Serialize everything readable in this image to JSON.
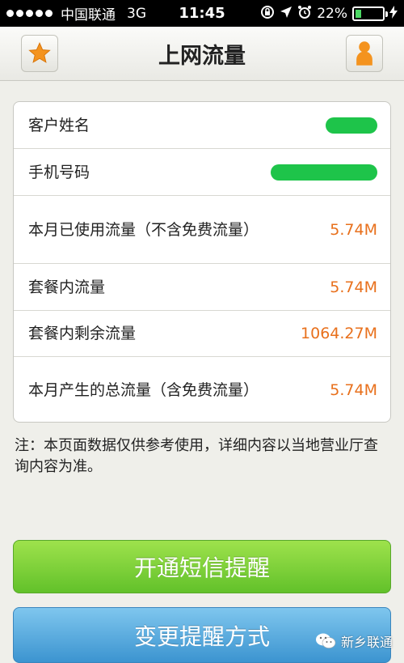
{
  "status_bar": {
    "carrier": "中国联通",
    "network": "3G",
    "time": "11:45",
    "battery": "22%",
    "battery_level": 0.22
  },
  "nav": {
    "title": "上网流量",
    "left_icon": "star-icon",
    "right_icon": "person-icon"
  },
  "rows": [
    {
      "label": "客户姓名",
      "value": ""
    },
    {
      "label": "手机号码",
      "value": ""
    },
    {
      "label": "本月已使用流量（不含免费流量）",
      "value": "5.74M"
    },
    {
      "label": "套餐内流量",
      "value": "5.74M"
    },
    {
      "label": "套餐内剩余流量",
      "value": "1064.27M"
    },
    {
      "label": "本月产生的总流量（含免费流量）",
      "value": "5.74M"
    }
  ],
  "note": "注：本页面数据仅供参考使用，详细内容以当地营业厅查询内容为准。",
  "buttons": {
    "sms_reminder": "开通短信提醒",
    "change_method": "变更提醒方式"
  },
  "watermark": "新乡联通",
  "colors": {
    "accent_orange": "#e8701c",
    "button_green": "#62c12a",
    "button_blue": "#3c94d0"
  }
}
